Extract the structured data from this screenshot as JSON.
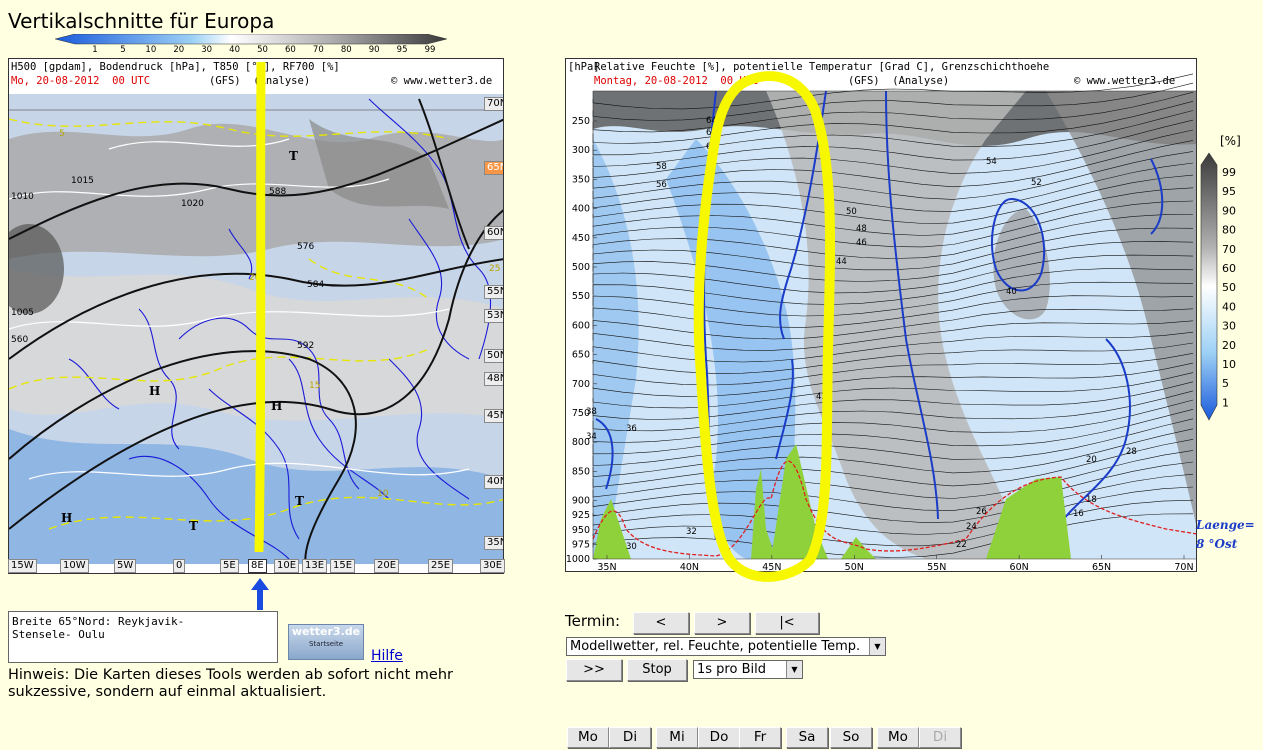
{
  "page": {
    "title": "Vertikalschnitte für Europa"
  },
  "scale": {
    "ticks": [
      "1",
      "5",
      "10",
      "20",
      "30",
      "40",
      "50",
      "60",
      "70",
      "80",
      "90",
      "95",
      "99"
    ]
  },
  "map": {
    "header_line1": "H500 [gpdam], Bodendruck [hPa], T850 [°C], RF700 [%]",
    "header_date": "Mo, 20-08-2012  00 UTC",
    "header_model": "(GFS)  (Analyse)",
    "copyright": "© www.wetter3.de",
    "lat_labels": [
      "70N",
      "65N",
      "60N",
      "55N",
      "53N",
      "50N",
      "48N",
      "45N",
      "40N",
      "35N"
    ],
    "selected_lat": "65N",
    "lon_labels": [
      "15W",
      "10W",
      "5W",
      "0",
      "5E",
      "8E",
      "10E",
      "13E",
      "15E",
      "20E",
      "25E",
      "30E"
    ],
    "selected_lon": "8E",
    "contour_labels": [
      "588",
      "576",
      "584",
      "592",
      "560",
      "1020",
      "1015",
      "1010",
      "1005"
    ],
    "pressure_labels": [
      "T",
      "H",
      "H",
      "T",
      "T",
      "H",
      "H"
    ],
    "temp_labels": [
      "5",
      "10",
      "15",
      "20",
      "25"
    ]
  },
  "section": {
    "header_line1": "Relative Feuchte [%], potentielle Temperatur [Grad C], Grenzschichthoehe",
    "header_date": "Montag, 20-08-2012  00 UTC",
    "header_model": "(GFS)  (Analyse)",
    "copyright": "© www.wetter3.de",
    "unit": "[hPa]",
    "levels": [
      "250",
      "300",
      "350",
      "400",
      "450",
      "500",
      "550",
      "600",
      "650",
      "700",
      "750",
      "800",
      "850",
      "900",
      "925",
      "950",
      "975",
      "1000"
    ],
    "lat_ticks": [
      "35N",
      "40N",
      "45N",
      "50N",
      "55N",
      "60N",
      "65N",
      "70N"
    ],
    "theta_labels": [
      "64",
      "62",
      "60",
      "58",
      "56",
      "54",
      "52",
      "50",
      "48",
      "46",
      "44",
      "42",
      "40",
      "38",
      "36",
      "34",
      "32",
      "30",
      "28",
      "26",
      "24",
      "22",
      "20",
      "18",
      "16"
    ]
  },
  "legend": {
    "unit": "[%]",
    "labels": [
      "99",
      "95",
      "90",
      "80",
      "70",
      "60",
      "50",
      "40",
      "30",
      "20",
      "10",
      "5",
      "1"
    ]
  },
  "laenge": {
    "line1": "Laenge=",
    "line2": "8  °Ost"
  },
  "info": {
    "line1": "Breite 65°Nord: Reykjavik-",
    "line2": "Stensele- Oulu"
  },
  "logo": {
    "title": "wetter3.de",
    "subtitle": "Startseite"
  },
  "links": {
    "hilfe": "Hilfe"
  },
  "hinweis": "Hinweis: Die Karten dieses Tools werden ab sofort nicht mehr sukzessive, sondern auf einmal aktualisiert.",
  "controls": {
    "termin_label": "Termin:",
    "prev": "<",
    "next": ">",
    "first": "|<",
    "product_select": "Modellwetter, rel. Feuchte, potentielle Temp.",
    "play": ">>",
    "stop": "Stop",
    "speed_select": "1s pro Bild"
  },
  "days": [
    "Mo",
    "Di",
    "Mi",
    "Do",
    "Fr",
    "Sa",
    "So",
    "Mo",
    "Di"
  ],
  "colors": {
    "background": "#ffffe1",
    "highlight": "#f7f700",
    "terrain": "#8fd13a",
    "coast": "#1a1ad8"
  }
}
